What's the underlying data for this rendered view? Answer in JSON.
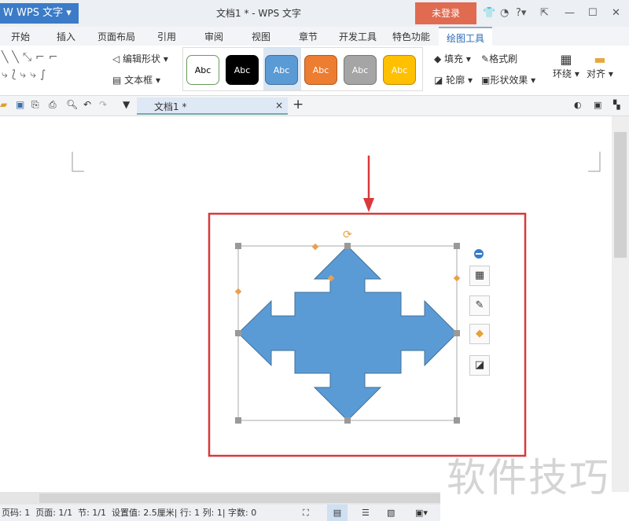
{
  "app": {
    "name": "WPS 文字",
    "title": "文档1 * - WPS 文字",
    "login": "未登录"
  },
  "tabs": [
    "开始",
    "插入",
    "页面布局",
    "引用",
    "审阅",
    "视图",
    "章节",
    "开发工具",
    "特色功能",
    "绘图工具"
  ],
  "ribbon": {
    "edit_shape": "编辑形状",
    "textbox": "文本框",
    "style_label": "Abc",
    "styles": [
      {
        "bg": "#ffffff",
        "fg": "#000000",
        "border": "#6a9a5a"
      },
      {
        "bg": "#000000",
        "fg": "#ffffff",
        "border": "#000"
      },
      {
        "bg": "#5b9bd5",
        "fg": "#ffffff",
        "border": "#41719c"
      },
      {
        "bg": "#ed7d31",
        "fg": "#ffffff",
        "border": "#ae5a21"
      },
      {
        "bg": "#a5a5a5",
        "fg": "#ffffff",
        "border": "#787878"
      },
      {
        "bg": "#ffc000",
        "fg": "#ffffff",
        "border": "#bc8c00"
      }
    ],
    "fill": "填充",
    "format_painter": "格式刷",
    "outline": "轮廓",
    "shape_effects": "形状效果",
    "wrap": "环绕",
    "align": "对齐"
  },
  "doc_tab": {
    "label": "文档1 *",
    "close": "×",
    "add": "+"
  },
  "status": {
    "page_no": "页码: 1",
    "pages": "页面: 1/1",
    "section": "节: 1/1",
    "setting": "设置值: 2.5厘米",
    "row": "行: 1",
    "col": "列: 1",
    "words": "字数: 0"
  },
  "watermark": "软件技巧",
  "colors": {
    "shape": "#5b9bd5",
    "highlight": "#d9393a"
  }
}
